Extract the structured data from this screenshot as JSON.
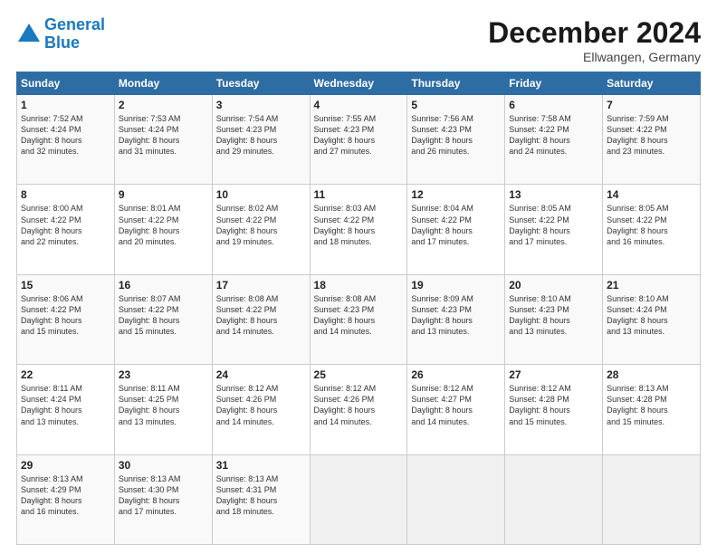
{
  "header": {
    "logo_line1": "General",
    "logo_line2": "Blue",
    "title": "December 2024",
    "subtitle": "Ellwangen, Germany"
  },
  "days_header": [
    "Sunday",
    "Monday",
    "Tuesday",
    "Wednesday",
    "Thursday",
    "Friday",
    "Saturday"
  ],
  "weeks": [
    [
      {
        "num": "1",
        "lines": [
          "Sunrise: 7:52 AM",
          "Sunset: 4:24 PM",
          "Daylight: 8 hours",
          "and 32 minutes."
        ]
      },
      {
        "num": "2",
        "lines": [
          "Sunrise: 7:53 AM",
          "Sunset: 4:24 PM",
          "Daylight: 8 hours",
          "and 31 minutes."
        ]
      },
      {
        "num": "3",
        "lines": [
          "Sunrise: 7:54 AM",
          "Sunset: 4:23 PM",
          "Daylight: 8 hours",
          "and 29 minutes."
        ]
      },
      {
        "num": "4",
        "lines": [
          "Sunrise: 7:55 AM",
          "Sunset: 4:23 PM",
          "Daylight: 8 hours",
          "and 27 minutes."
        ]
      },
      {
        "num": "5",
        "lines": [
          "Sunrise: 7:56 AM",
          "Sunset: 4:23 PM",
          "Daylight: 8 hours",
          "and 26 minutes."
        ]
      },
      {
        "num": "6",
        "lines": [
          "Sunrise: 7:58 AM",
          "Sunset: 4:22 PM",
          "Daylight: 8 hours",
          "and 24 minutes."
        ]
      },
      {
        "num": "7",
        "lines": [
          "Sunrise: 7:59 AM",
          "Sunset: 4:22 PM",
          "Daylight: 8 hours",
          "and 23 minutes."
        ]
      }
    ],
    [
      {
        "num": "8",
        "lines": [
          "Sunrise: 8:00 AM",
          "Sunset: 4:22 PM",
          "Daylight: 8 hours",
          "and 22 minutes."
        ]
      },
      {
        "num": "9",
        "lines": [
          "Sunrise: 8:01 AM",
          "Sunset: 4:22 PM",
          "Daylight: 8 hours",
          "and 20 minutes."
        ]
      },
      {
        "num": "10",
        "lines": [
          "Sunrise: 8:02 AM",
          "Sunset: 4:22 PM",
          "Daylight: 8 hours",
          "and 19 minutes."
        ]
      },
      {
        "num": "11",
        "lines": [
          "Sunrise: 8:03 AM",
          "Sunset: 4:22 PM",
          "Daylight: 8 hours",
          "and 18 minutes."
        ]
      },
      {
        "num": "12",
        "lines": [
          "Sunrise: 8:04 AM",
          "Sunset: 4:22 PM",
          "Daylight: 8 hours",
          "and 17 minutes."
        ]
      },
      {
        "num": "13",
        "lines": [
          "Sunrise: 8:05 AM",
          "Sunset: 4:22 PM",
          "Daylight: 8 hours",
          "and 17 minutes."
        ]
      },
      {
        "num": "14",
        "lines": [
          "Sunrise: 8:05 AM",
          "Sunset: 4:22 PM",
          "Daylight: 8 hours",
          "and 16 minutes."
        ]
      }
    ],
    [
      {
        "num": "15",
        "lines": [
          "Sunrise: 8:06 AM",
          "Sunset: 4:22 PM",
          "Daylight: 8 hours",
          "and 15 minutes."
        ]
      },
      {
        "num": "16",
        "lines": [
          "Sunrise: 8:07 AM",
          "Sunset: 4:22 PM",
          "Daylight: 8 hours",
          "and 15 minutes."
        ]
      },
      {
        "num": "17",
        "lines": [
          "Sunrise: 8:08 AM",
          "Sunset: 4:22 PM",
          "Daylight: 8 hours",
          "and 14 minutes."
        ]
      },
      {
        "num": "18",
        "lines": [
          "Sunrise: 8:08 AM",
          "Sunset: 4:23 PM",
          "Daylight: 8 hours",
          "and 14 minutes."
        ]
      },
      {
        "num": "19",
        "lines": [
          "Sunrise: 8:09 AM",
          "Sunset: 4:23 PM",
          "Daylight: 8 hours",
          "and 13 minutes."
        ]
      },
      {
        "num": "20",
        "lines": [
          "Sunrise: 8:10 AM",
          "Sunset: 4:23 PM",
          "Daylight: 8 hours",
          "and 13 minutes."
        ]
      },
      {
        "num": "21",
        "lines": [
          "Sunrise: 8:10 AM",
          "Sunset: 4:24 PM",
          "Daylight: 8 hours",
          "and 13 minutes."
        ]
      }
    ],
    [
      {
        "num": "22",
        "lines": [
          "Sunrise: 8:11 AM",
          "Sunset: 4:24 PM",
          "Daylight: 8 hours",
          "and 13 minutes."
        ]
      },
      {
        "num": "23",
        "lines": [
          "Sunrise: 8:11 AM",
          "Sunset: 4:25 PM",
          "Daylight: 8 hours",
          "and 13 minutes."
        ]
      },
      {
        "num": "24",
        "lines": [
          "Sunrise: 8:12 AM",
          "Sunset: 4:26 PM",
          "Daylight: 8 hours",
          "and 14 minutes."
        ]
      },
      {
        "num": "25",
        "lines": [
          "Sunrise: 8:12 AM",
          "Sunset: 4:26 PM",
          "Daylight: 8 hours",
          "and 14 minutes."
        ]
      },
      {
        "num": "26",
        "lines": [
          "Sunrise: 8:12 AM",
          "Sunset: 4:27 PM",
          "Daylight: 8 hours",
          "and 14 minutes."
        ]
      },
      {
        "num": "27",
        "lines": [
          "Sunrise: 8:12 AM",
          "Sunset: 4:28 PM",
          "Daylight: 8 hours",
          "and 15 minutes."
        ]
      },
      {
        "num": "28",
        "lines": [
          "Sunrise: 8:13 AM",
          "Sunset: 4:28 PM",
          "Daylight: 8 hours",
          "and 15 minutes."
        ]
      }
    ],
    [
      {
        "num": "29",
        "lines": [
          "Sunrise: 8:13 AM",
          "Sunset: 4:29 PM",
          "Daylight: 8 hours",
          "and 16 minutes."
        ]
      },
      {
        "num": "30",
        "lines": [
          "Sunrise: 8:13 AM",
          "Sunset: 4:30 PM",
          "Daylight: 8 hours",
          "and 17 minutes."
        ]
      },
      {
        "num": "31",
        "lines": [
          "Sunrise: 8:13 AM",
          "Sunset: 4:31 PM",
          "Daylight: 8 hours",
          "and 18 minutes."
        ]
      },
      null,
      null,
      null,
      null
    ]
  ]
}
